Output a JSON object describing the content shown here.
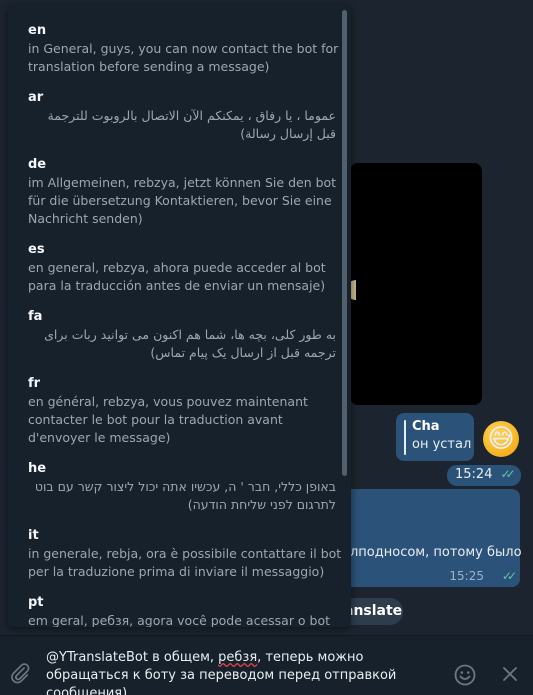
{
  "chat": {
    "reply": {
      "name": "Cha",
      "text": "он устал"
    },
    "emoji": "😅",
    "time_1": "15:24",
    "message_tail": "лподносом, потому было",
    "time_2": "15:25",
    "translate_label": "anslate",
    "check_mark": "✓✓"
  },
  "translations": [
    {
      "code": "en",
      "text": "in General, guys, you can now contact the bot for translation before sending a message)"
    },
    {
      "code": "ar",
      "text": "عموما ، يا رفاق ، يمكنكم الآن الاتصال بالروبوت للترجمة قبل إرسال رسالة)"
    },
    {
      "code": "de",
      "text": "im Allgemeinen, rebzya, jetzt können Sie den bot für die übersetzung Kontaktieren, bevor Sie eine Nachricht senden)"
    },
    {
      "code": "es",
      "text": "en general, rebzya, ahora puede acceder al bot para la traducción antes de enviar un mensaje)"
    },
    {
      "code": "fa",
      "text": "به طور کلی، بچه ها، شما هم اکنون می توانید ربات برای ترجمه قبل از ارسال یک پیام تماس)"
    },
    {
      "code": "fr",
      "text": "en général, rebzya, vous pouvez maintenant contacter le bot pour la traduction avant d'envoyer le message)"
    },
    {
      "code": "he",
      "text": "באופן כללי, חבר ' ה, עכשיו אתה יכול ליצור קשר עם בוט לתרגום לפני שליחת הודעה)"
    },
    {
      "code": "it",
      "text": "in generale, rebja, ora è possibile contattare il bot per la traduzione prima di inviare il messaggio)"
    },
    {
      "code": "pt",
      "text": "em geral, ребзя, agora você pode acessar o bot"
    }
  ],
  "input": {
    "text_before": "@YTranslateBot в общем, ",
    "text_misspelled": "ребзя",
    "text_after": ", теперь можно обращаться к боту за переводом перед отправкой сообщения)"
  },
  "icons": {
    "attach": "paperclip-icon",
    "emoji": "smile-icon",
    "close": "close-icon"
  }
}
